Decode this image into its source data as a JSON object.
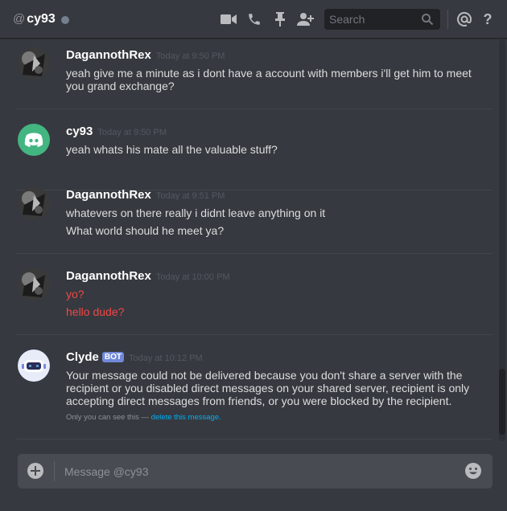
{
  "header": {
    "at_symbol": "@",
    "channel_name": "cy93",
    "search_placeholder": "Search",
    "help_label": "?"
  },
  "messages": [
    {
      "author": "DagannothRex",
      "timestamp": "Today at 9:50 PM",
      "avatar": "photo-avatar",
      "lines": [
        "yeah give me a minute as i dont have a account with members i'll get him to meet you grand exchange?"
      ]
    },
    {
      "author": "cy93",
      "timestamp": "Today at 9:50 PM",
      "avatar": "discord-logo-avatar",
      "avatar_color": "#43b581",
      "lines": [
        "yeah whats his mate all the valuable stuff?"
      ]
    },
    {
      "author": "DagannothRex",
      "timestamp": "Today at 9:51 PM",
      "avatar": "photo-avatar",
      "lines": [
        "whatevers on there really i didnt leave anything on it",
        "What world should he meet ya?"
      ]
    },
    {
      "author": "DagannothRex",
      "timestamp": "Today at 10:00 PM",
      "avatar": "photo-avatar",
      "lines": [
        "yo?",
        "hello dude?"
      ],
      "line_color": "#f04747"
    },
    {
      "author": "Clyde",
      "bot_tag": "BOT",
      "timestamp": "Today at 10:12 PM",
      "avatar": "clyde-bot-avatar",
      "avatar_color": "#7289da",
      "lines": [
        "Your message could not be delivered because you don't share a server with the recipient or you disabled direct messages on your shared server, recipient is only accepting direct messages from friends, or you were blocked by the recipient."
      ],
      "ephemeral_text": "Only you can see this —",
      "ephemeral_link": "delete this message."
    }
  ],
  "composer": {
    "placeholder": "Message @cy93"
  },
  "colors": {
    "background": "#36393f",
    "accent": "#7289da",
    "link": "#00b0f4",
    "error_text": "#f04747"
  }
}
